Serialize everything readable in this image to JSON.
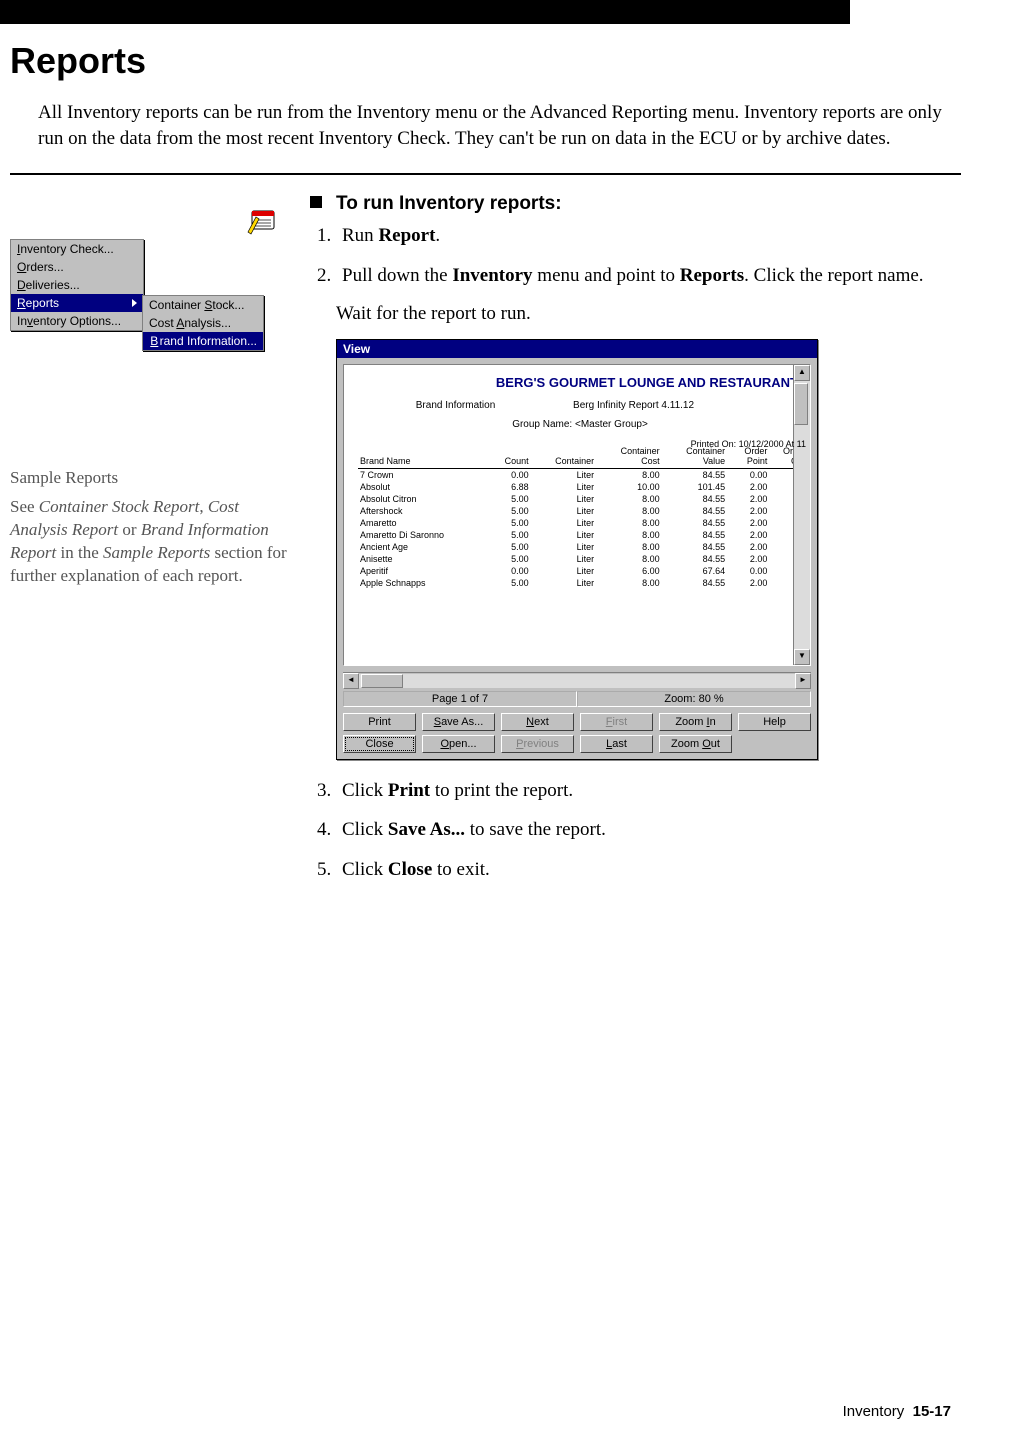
{
  "page": {
    "heading": "Reports",
    "intro": "All Inventory reports can be run from the Inventory menu or the Advanced Reporting menu. Inventory reports are only run on the data from the most recent Inventory Check. They can't be run on data in the ECU or by archive dates.",
    "footer_section": "Inventory",
    "footer_page": "15-17"
  },
  "menu": {
    "items": [
      {
        "label_pre": "",
        "label_u": "I",
        "label_post": "nventory Check..."
      },
      {
        "label_pre": "",
        "label_u": "O",
        "label_post": "rders..."
      },
      {
        "label_pre": "",
        "label_u": "D",
        "label_post": "eliveries..."
      },
      {
        "label_pre": "",
        "label_u": "R",
        "label_post": "eports",
        "selected": true,
        "hasSub": true
      },
      {
        "label_pre": "In",
        "label_u": "v",
        "label_post": "entory Options..."
      }
    ],
    "sub": [
      {
        "label_pre": "Container ",
        "label_u": "S",
        "label_post": "tock..."
      },
      {
        "label_pre": "Cost ",
        "label_u": "A",
        "label_post": "nalysis..."
      },
      {
        "label_pre": "",
        "label_u": "B",
        "label_post": "rand Information...",
        "selected": true
      }
    ]
  },
  "sidebar": {
    "title": "Sample Reports",
    "body_pre": "See ",
    "em1": "Container Stock Report",
    "sep1": ", ",
    "em2": "Cost Analysis Report",
    "sep2": " or ",
    "em3": "Brand Information Report",
    "body_mid": " in the ",
    "em4": "Sample Reports",
    "body_post": " section for further explanation of each report."
  },
  "procedure": {
    "heading": "To run Inventory reports:",
    "step1_pre": "Run ",
    "step1_b": "Report",
    "step1_post": ".",
    "step2_pre": "Pull down the ",
    "step2_b1": "Inventory",
    "step2_mid": " menu and point to ",
    "step2_b2": "Reports",
    "step2_post": ". Click the report name.",
    "wait": "Wait for the report to run.",
    "step3_pre": "Click ",
    "step3_b": "Print",
    "step3_post": " to print the report.",
    "step4_pre": "Click ",
    "step4_b": "Save As...",
    "step4_post": " to save the report.",
    "step5_pre": "Click ",
    "step5_b": "Close",
    "step5_post": " to exit."
  },
  "viewer": {
    "title": "View",
    "doc_title": "BERG'S GOURMET LOUNGE AND RESTAURANT",
    "sub_left": "Brand Information",
    "sub_right": "Berg Infinity Report 4.11.12",
    "group": "Group Name: <Master Group>",
    "printed": "Printed On: 10/12/2000 At 11",
    "status_page": "Page 1 of 7",
    "status_zoom": "Zoom: 80 %",
    "buttons": {
      "print": "Print",
      "saveas_u": "S",
      "saveas_rest": "ave As...",
      "close": "Close",
      "open_u": "O",
      "open_rest": "pen...",
      "next_u": "N",
      "next_rest": "ext",
      "prev_u": "P",
      "prev_rest": "revious",
      "first_u": "F",
      "first_rest": "irst",
      "last_u": "L",
      "last_rest": "ast",
      "zin_pre": "Zoom ",
      "zin_u": "I",
      "zin_post": "n",
      "zout_pre": "Zoom ",
      "zout_u": "O",
      "zout_post": "ut",
      "help": "Help"
    },
    "columns": [
      "Brand Name",
      "Count",
      "Container",
      "Container Cost",
      "Container Value",
      "Order Point",
      "Ord Q"
    ]
  },
  "chart_data": {
    "type": "table",
    "title": "Brand Information",
    "columns": [
      "Brand Name",
      "Count",
      "Container",
      "Container Cost",
      "Container Value",
      "Order Point"
    ],
    "rows": [
      [
        "7 Crown",
        0.0,
        "Liter",
        8.0,
        84.55,
        0.0
      ],
      [
        "Absolut",
        6.88,
        "Liter",
        10.0,
        101.45,
        2.0
      ],
      [
        "Absolut Citron",
        5.0,
        "Liter",
        8.0,
        84.55,
        2.0
      ],
      [
        "Aftershock",
        5.0,
        "Liter",
        8.0,
        84.55,
        2.0
      ],
      [
        "Amaretto",
        5.0,
        "Liter",
        8.0,
        84.55,
        2.0
      ],
      [
        "Amaretto Di Saronno",
        5.0,
        "Liter",
        8.0,
        84.55,
        2.0
      ],
      [
        "Ancient Age",
        5.0,
        "Liter",
        8.0,
        84.55,
        2.0
      ],
      [
        "Anisette",
        5.0,
        "Liter",
        8.0,
        84.55,
        2.0
      ],
      [
        "Aperitif",
        0.0,
        "Liter",
        6.0,
        67.64,
        0.0
      ],
      [
        "Apple Schnapps",
        5.0,
        "Liter",
        8.0,
        84.55,
        2.0
      ]
    ]
  }
}
